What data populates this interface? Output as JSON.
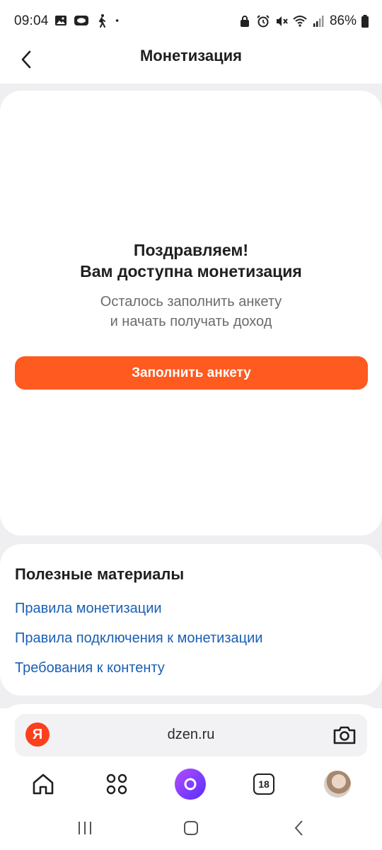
{
  "status_bar": {
    "time": "09:04",
    "battery_pct": "86%",
    "left_icons": [
      "gallery-icon",
      "ring-icon",
      "walking-icon",
      "dot-icon"
    ],
    "right_icons": [
      "lock-icon",
      "alarm-icon",
      "mute-icon",
      "wifi-icon",
      "signal-icon",
      "battery-icon"
    ]
  },
  "header": {
    "title": "Монетизация",
    "back_icon": "chevron-left-icon"
  },
  "main_card": {
    "title_line1": "Поздравляем!",
    "title_line2": "Вам доступна монетизация",
    "subtitle_line1": "Осталось заполнить анкету",
    "subtitle_line2": "и начать получать доход",
    "cta_label": "Заполнить анкету"
  },
  "materials": {
    "title": "Полезные материалы",
    "links": [
      "Правила монетизации",
      "Правила подключения к монетизации",
      "Требования к контенту"
    ]
  },
  "browser": {
    "logo_letter": "Я",
    "url": "dzen.ru",
    "tabs_count": "18",
    "nav_icons": [
      "home-icon",
      "services-grid-icon",
      "alice-icon",
      "tabs-icon",
      "avatar"
    ]
  },
  "colors": {
    "accent": "#ff5a1f",
    "link": "#1a5fb4",
    "yandex_red": "#fc3f1d",
    "page_bg": "#efeff1",
    "alice_purple": "#8a3cff"
  }
}
